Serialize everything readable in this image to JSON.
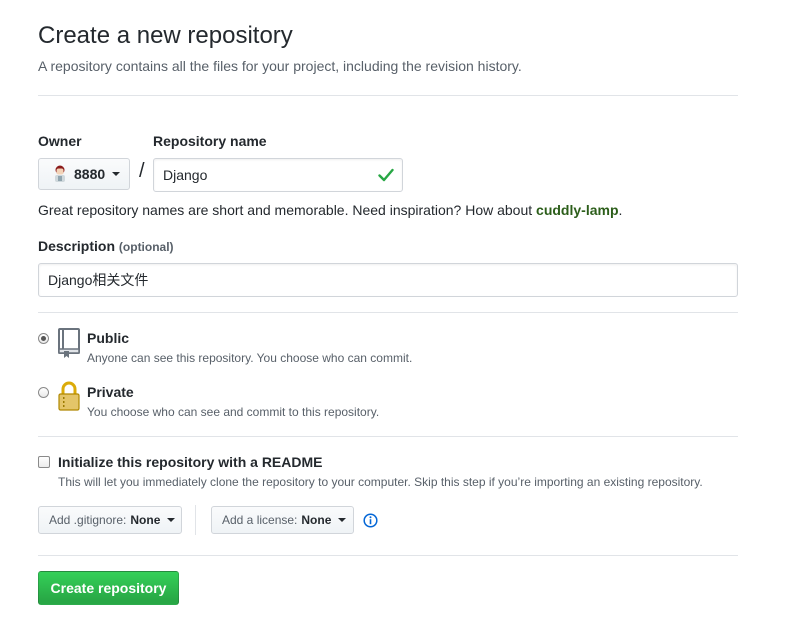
{
  "header": {
    "title": "Create a new repository",
    "subtitle": "A repository contains all the files for your project, including the revision history."
  },
  "owner": {
    "label": "Owner",
    "value": "8880",
    "avatar_icon": "user-avatar"
  },
  "separator": "/",
  "repository_name": {
    "label": "Repository name",
    "value": "Django",
    "valid_icon": "check-icon",
    "valid_color": "#28a745"
  },
  "hint": {
    "text": "Great repository names are short and memorable. Need inspiration? How about ",
    "suggestion": "cuddly-lamp",
    "suffix": "."
  },
  "description": {
    "label": "Description",
    "optional": "(optional)",
    "value": "Django相关文件"
  },
  "visibility": {
    "selected": "public",
    "options": [
      {
        "id": "public",
        "title": "Public",
        "description": "Anyone can see this repository. You choose who can commit.",
        "icon": "repo-book-icon"
      },
      {
        "id": "private",
        "title": "Private",
        "description": "You choose who can see and commit to this repository.",
        "icon": "lock-icon"
      }
    ]
  },
  "readme": {
    "checked": false,
    "title": "Initialize this repository with a README",
    "description": "This will let you immediately clone the repository to your computer. Skip this step if you’re importing an existing repository."
  },
  "gitignore": {
    "prefix": "Add .gitignore:",
    "value": "None"
  },
  "license": {
    "prefix": "Add a license:",
    "value": "None",
    "info_icon": "info-icon"
  },
  "submit": {
    "label": "Create repository",
    "color": "#28a745"
  }
}
